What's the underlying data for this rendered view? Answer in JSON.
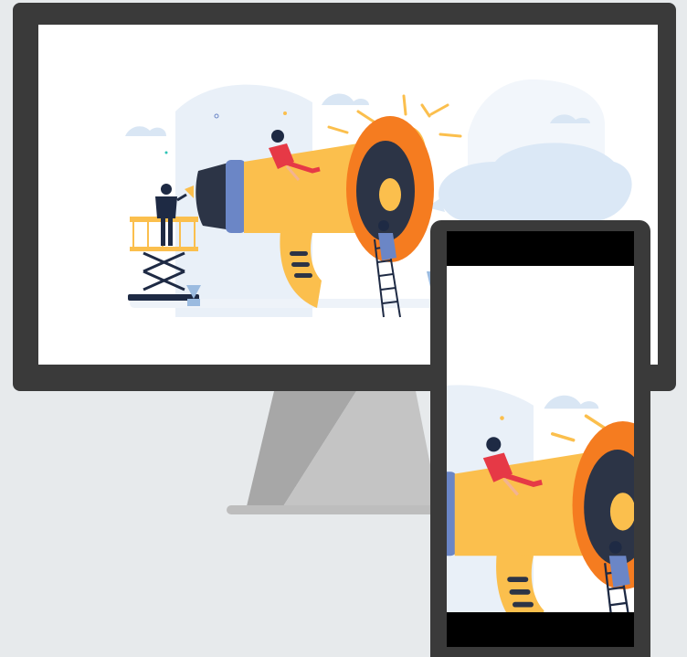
{
  "scene": {
    "description_icons": [
      "monitor",
      "phone",
      "megaphone-illustration"
    ],
    "colors": {
      "background": "#e7eaec",
      "device_frame": "#3a3a3a",
      "megaphone_body": "#fbbf4d",
      "megaphone_mouth": "#f57c20",
      "megaphone_back": "#2c3446",
      "megaphone_band": "#6b86c6",
      "sky_shape": "#e6eef8"
    }
  }
}
